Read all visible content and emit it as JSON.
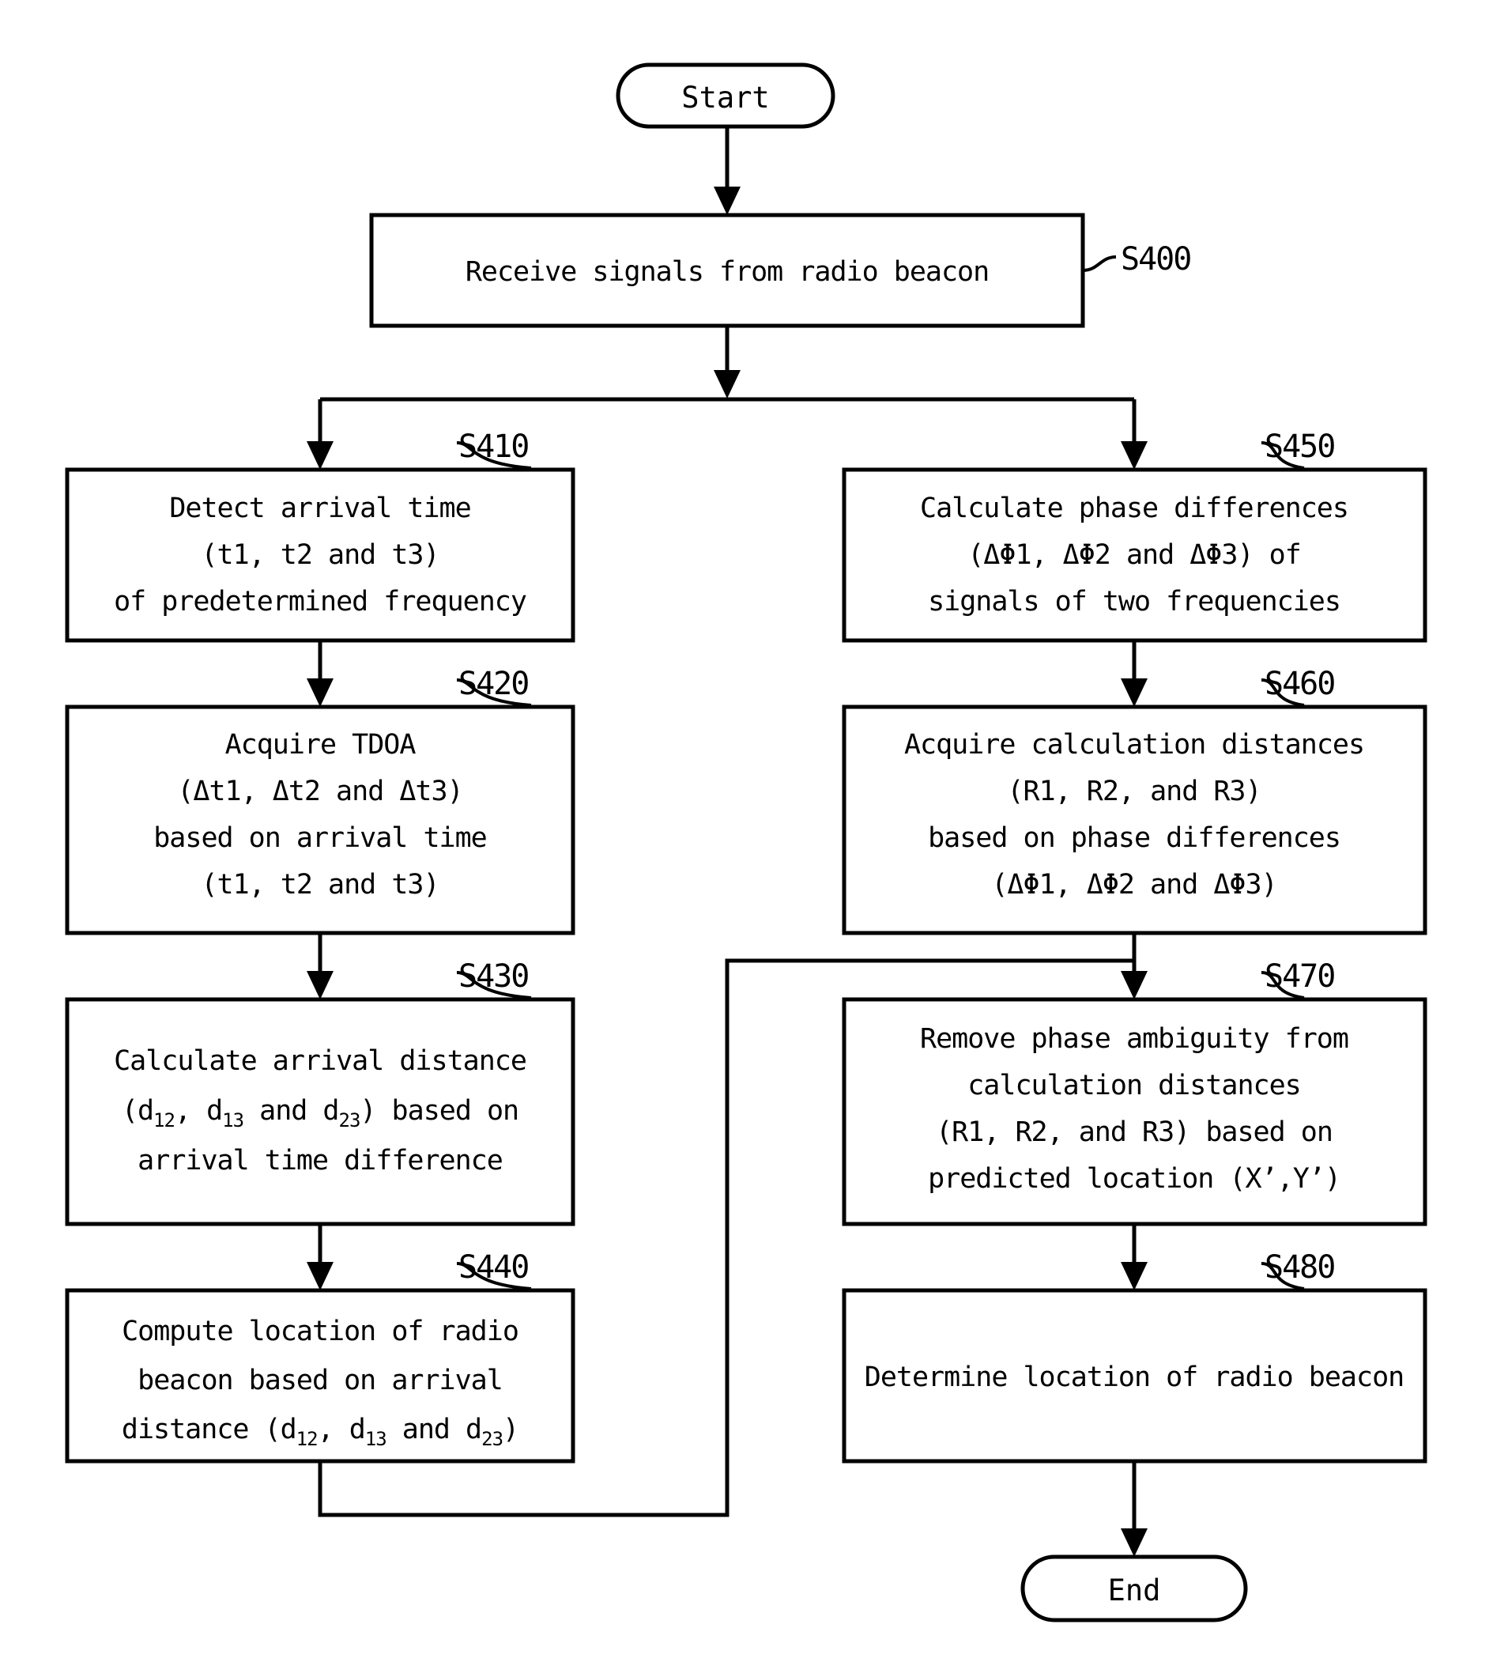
{
  "diagram": {
    "type": "flowchart",
    "title": "Radio beacon location determination flowchart",
    "terminals": {
      "start": "Start",
      "end": "End"
    },
    "nodes": [
      {
        "id": "S400",
        "label": "S400",
        "lines": [
          "Receive signals from radio beacon"
        ]
      },
      {
        "id": "S410",
        "label": "S410",
        "lines": [
          "Detect arrival time",
          "(t1, t2 and t3)",
          "of predetermined frequency"
        ]
      },
      {
        "id": "S420",
        "label": "S420",
        "lines": [
          "Acquire TDOA",
          "(Δt1, Δt2 and Δt3)",
          "based on arrival time",
          "(t1, t2 and t3)"
        ]
      },
      {
        "id": "S430",
        "label": "S430",
        "lines": [
          "Calculate arrival distance",
          "(d12, d13 and d23) based on",
          "arrival time difference"
        ]
      },
      {
        "id": "S440",
        "label": "S440",
        "lines": [
          "Compute location of radio",
          "beacon based on arrival",
          "distance (d12, d13 and d23)"
        ]
      },
      {
        "id": "S450",
        "label": "S450",
        "lines": [
          "Calculate phase differences",
          "(ΔΦ1, ΔΦ2 and ΔΦ3) of",
          "signals of two frequencies"
        ]
      },
      {
        "id": "S460",
        "label": "S460",
        "lines": [
          "Acquire calculation distances",
          "(R1, R2, and R3)",
          "based on phase differences",
          "(ΔΦ1, ΔΦ2 and ΔΦ3)"
        ]
      },
      {
        "id": "S470",
        "label": "S470",
        "lines": [
          "Remove phase ambiguity from",
          "calculation distances",
          "(R1, R2, and R3) based on",
          "predicted location (X’,Y’)"
        ]
      },
      {
        "id": "S480",
        "label": "S480",
        "lines": [
          "Determine location of radio beacon"
        ]
      }
    ],
    "colors": {
      "stroke": "#000000",
      "fill": "#ffffff"
    }
  },
  "text": {
    "start": "Start",
    "end": "End",
    "s400_l1": "Receive signals from radio beacon",
    "s400_tag": "S400",
    "s410_l1": "Detect arrival time",
    "s410_l2": "(t1,  t2 and t3)",
    "s410_l3": "of predetermined frequency",
    "s410_tag": "S410",
    "s420_l1": "Acquire TDOA",
    "s420_l2": "(Δt1,  Δt2 and Δt3)",
    "s420_l3": "based on arrival time",
    "s420_l4": "(t1,  t2 and t3)",
    "s420_tag": "S420",
    "s430_l1": "Calculate arrival distance",
    "s430_l2a": "(d",
    "s430_l2b": "12",
    "s430_l2c": ",  d",
    "s430_l2d": "13",
    "s430_l2e": " and d",
    "s430_l2f": "23",
    "s430_l2g": ") based on",
    "s430_l3": "arrival time difference",
    "s430_tag": "S430",
    "s440_l1": "Compute location of radio",
    "s440_l2": "beacon based on arrival",
    "s440_l3a": "distance (d",
    "s440_l3b": "12",
    "s440_l3c": ",  d",
    "s440_l3d": "13",
    "s440_l3e": " and d",
    "s440_l3f": "23",
    "s440_l3g": ")",
    "s440_tag": "S440",
    "s450_l1": "Calculate phase differences",
    "s450_l2": "(ΔΦ1,  ΔΦ2 and ΔΦ3) of",
    "s450_l3": "signals of two frequencies",
    "s450_tag": "S450",
    "s460_l1": "Acquire calculation distances",
    "s460_l2": "(R1,  R2,  and R3)",
    "s460_l3": "based on phase differences",
    "s460_l4": "(ΔΦ1,  ΔΦ2 and ΔΦ3)",
    "s460_tag": "S460",
    "s470_l1": "Remove phase ambiguity from",
    "s470_l2": "calculation distances",
    "s470_l3": "(R1,  R2,  and R3) based on",
    "s470_l4": "predicted location (X’,Y’)",
    "s470_tag": "S470",
    "s480_l1": "Determine location of radio beacon",
    "s480_tag": "S480"
  }
}
